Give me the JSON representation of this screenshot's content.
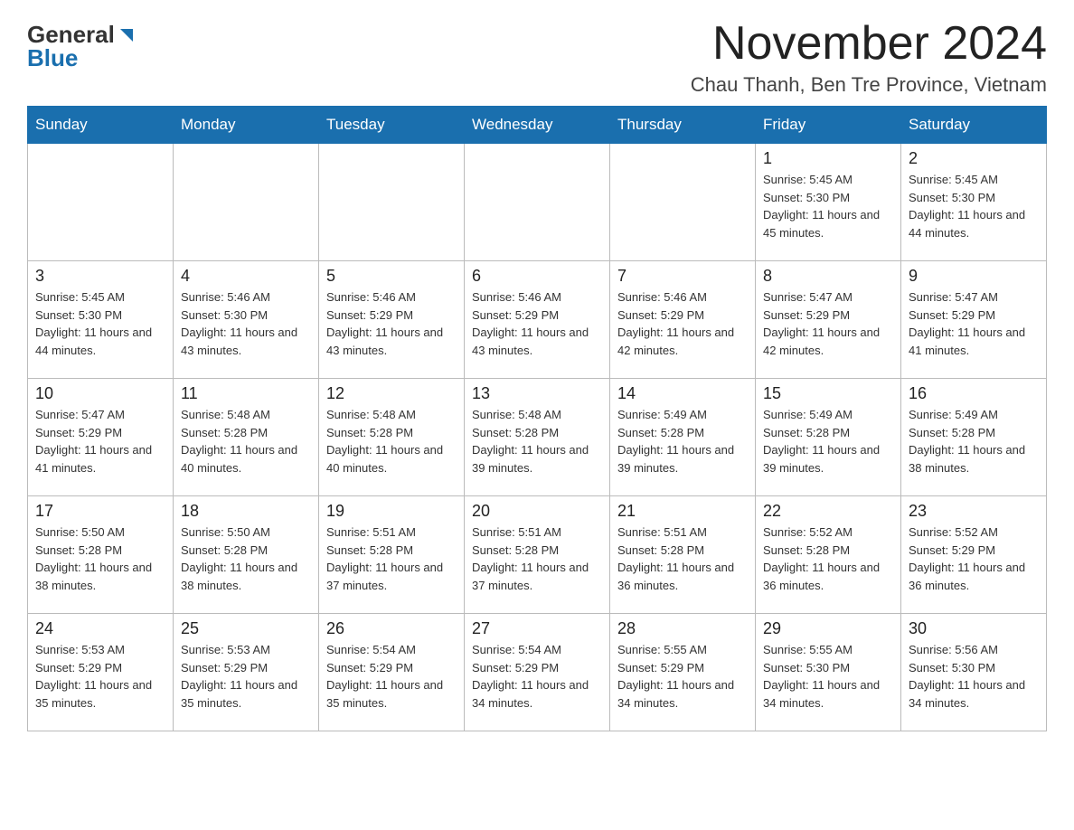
{
  "header": {
    "logo": {
      "general": "General",
      "blue": "Blue",
      "arrow": "▶"
    },
    "title": "November 2024",
    "location": "Chau Thanh, Ben Tre Province, Vietnam"
  },
  "days_of_week": [
    "Sunday",
    "Monday",
    "Tuesday",
    "Wednesday",
    "Thursday",
    "Friday",
    "Saturday"
  ],
  "weeks": [
    [
      {
        "day": "",
        "info": ""
      },
      {
        "day": "",
        "info": ""
      },
      {
        "day": "",
        "info": ""
      },
      {
        "day": "",
        "info": ""
      },
      {
        "day": "",
        "info": ""
      },
      {
        "day": "1",
        "info": "Sunrise: 5:45 AM\nSunset: 5:30 PM\nDaylight: 11 hours and 45 minutes."
      },
      {
        "day": "2",
        "info": "Sunrise: 5:45 AM\nSunset: 5:30 PM\nDaylight: 11 hours and 44 minutes."
      }
    ],
    [
      {
        "day": "3",
        "info": "Sunrise: 5:45 AM\nSunset: 5:30 PM\nDaylight: 11 hours and 44 minutes."
      },
      {
        "day": "4",
        "info": "Sunrise: 5:46 AM\nSunset: 5:30 PM\nDaylight: 11 hours and 43 minutes."
      },
      {
        "day": "5",
        "info": "Sunrise: 5:46 AM\nSunset: 5:29 PM\nDaylight: 11 hours and 43 minutes."
      },
      {
        "day": "6",
        "info": "Sunrise: 5:46 AM\nSunset: 5:29 PM\nDaylight: 11 hours and 43 minutes."
      },
      {
        "day": "7",
        "info": "Sunrise: 5:46 AM\nSunset: 5:29 PM\nDaylight: 11 hours and 42 minutes."
      },
      {
        "day": "8",
        "info": "Sunrise: 5:47 AM\nSunset: 5:29 PM\nDaylight: 11 hours and 42 minutes."
      },
      {
        "day": "9",
        "info": "Sunrise: 5:47 AM\nSunset: 5:29 PM\nDaylight: 11 hours and 41 minutes."
      }
    ],
    [
      {
        "day": "10",
        "info": "Sunrise: 5:47 AM\nSunset: 5:29 PM\nDaylight: 11 hours and 41 minutes."
      },
      {
        "day": "11",
        "info": "Sunrise: 5:48 AM\nSunset: 5:28 PM\nDaylight: 11 hours and 40 minutes."
      },
      {
        "day": "12",
        "info": "Sunrise: 5:48 AM\nSunset: 5:28 PM\nDaylight: 11 hours and 40 minutes."
      },
      {
        "day": "13",
        "info": "Sunrise: 5:48 AM\nSunset: 5:28 PM\nDaylight: 11 hours and 39 minutes."
      },
      {
        "day": "14",
        "info": "Sunrise: 5:49 AM\nSunset: 5:28 PM\nDaylight: 11 hours and 39 minutes."
      },
      {
        "day": "15",
        "info": "Sunrise: 5:49 AM\nSunset: 5:28 PM\nDaylight: 11 hours and 39 minutes."
      },
      {
        "day": "16",
        "info": "Sunrise: 5:49 AM\nSunset: 5:28 PM\nDaylight: 11 hours and 38 minutes."
      }
    ],
    [
      {
        "day": "17",
        "info": "Sunrise: 5:50 AM\nSunset: 5:28 PM\nDaylight: 11 hours and 38 minutes."
      },
      {
        "day": "18",
        "info": "Sunrise: 5:50 AM\nSunset: 5:28 PM\nDaylight: 11 hours and 38 minutes."
      },
      {
        "day": "19",
        "info": "Sunrise: 5:51 AM\nSunset: 5:28 PM\nDaylight: 11 hours and 37 minutes."
      },
      {
        "day": "20",
        "info": "Sunrise: 5:51 AM\nSunset: 5:28 PM\nDaylight: 11 hours and 37 minutes."
      },
      {
        "day": "21",
        "info": "Sunrise: 5:51 AM\nSunset: 5:28 PM\nDaylight: 11 hours and 36 minutes."
      },
      {
        "day": "22",
        "info": "Sunrise: 5:52 AM\nSunset: 5:28 PM\nDaylight: 11 hours and 36 minutes."
      },
      {
        "day": "23",
        "info": "Sunrise: 5:52 AM\nSunset: 5:29 PM\nDaylight: 11 hours and 36 minutes."
      }
    ],
    [
      {
        "day": "24",
        "info": "Sunrise: 5:53 AM\nSunset: 5:29 PM\nDaylight: 11 hours and 35 minutes."
      },
      {
        "day": "25",
        "info": "Sunrise: 5:53 AM\nSunset: 5:29 PM\nDaylight: 11 hours and 35 minutes."
      },
      {
        "day": "26",
        "info": "Sunrise: 5:54 AM\nSunset: 5:29 PM\nDaylight: 11 hours and 35 minutes."
      },
      {
        "day": "27",
        "info": "Sunrise: 5:54 AM\nSunset: 5:29 PM\nDaylight: 11 hours and 34 minutes."
      },
      {
        "day": "28",
        "info": "Sunrise: 5:55 AM\nSunset: 5:29 PM\nDaylight: 11 hours and 34 minutes."
      },
      {
        "day": "29",
        "info": "Sunrise: 5:55 AM\nSunset: 5:30 PM\nDaylight: 11 hours and 34 minutes."
      },
      {
        "day": "30",
        "info": "Sunrise: 5:56 AM\nSunset: 5:30 PM\nDaylight: 11 hours and 34 minutes."
      }
    ]
  ]
}
